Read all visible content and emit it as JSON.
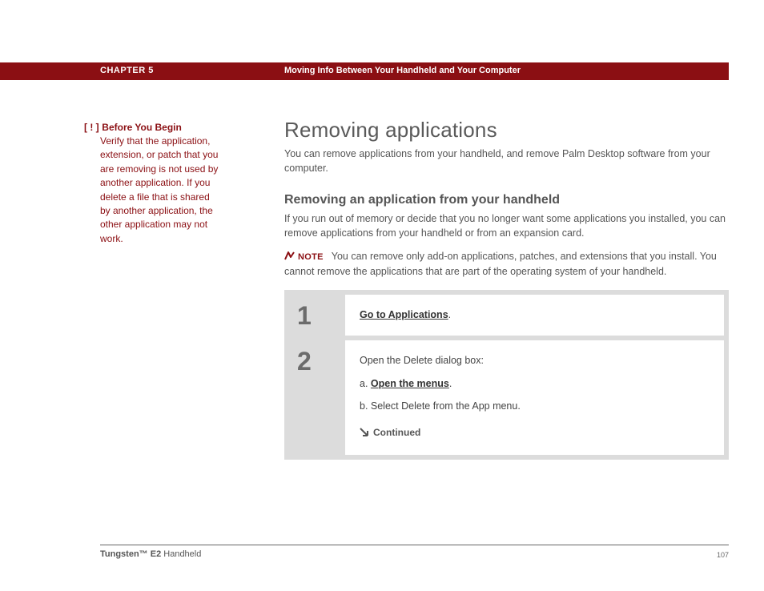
{
  "header": {
    "chapter": "CHAPTER 5",
    "title": "Moving Info Between Your Handheld and Your Computer"
  },
  "sidebar": {
    "tag": "[ ! ]",
    "title": "Before You Begin",
    "body": "Verify that the application, extension, or patch that you are removing is not used by another application. If you delete a file that is shared by another application, the other application may not work."
  },
  "main": {
    "h1": "Removing applications",
    "intro": "You can remove applications from your handheld, and remove Palm Desktop software from your computer.",
    "h2": "Removing an application from your handheld",
    "subintro": "If you run out of memory or decide that you no longer want some applications you installed, you can remove applications from your handheld or from an expansion card.",
    "note_label": "NOTE",
    "note_text": "You can remove only add-on applications, patches, and extensions that you install. You cannot remove the applications that are part of the operating system of your handheld.",
    "steps": [
      {
        "num": "1",
        "lead_link": "Go to Applications",
        "lead_after": "."
      },
      {
        "num": "2",
        "lead_text": "Open the Delete dialog box:",
        "sub_a_prefix": "a.  ",
        "sub_a_link": "Open the menus",
        "sub_a_after": ".",
        "sub_b": "b.  Select Delete from the App menu.",
        "continued": "Continued"
      }
    ]
  },
  "footer": {
    "product_bold": "Tungsten™ E2",
    "product_rest": " Handheld",
    "page": "107"
  }
}
